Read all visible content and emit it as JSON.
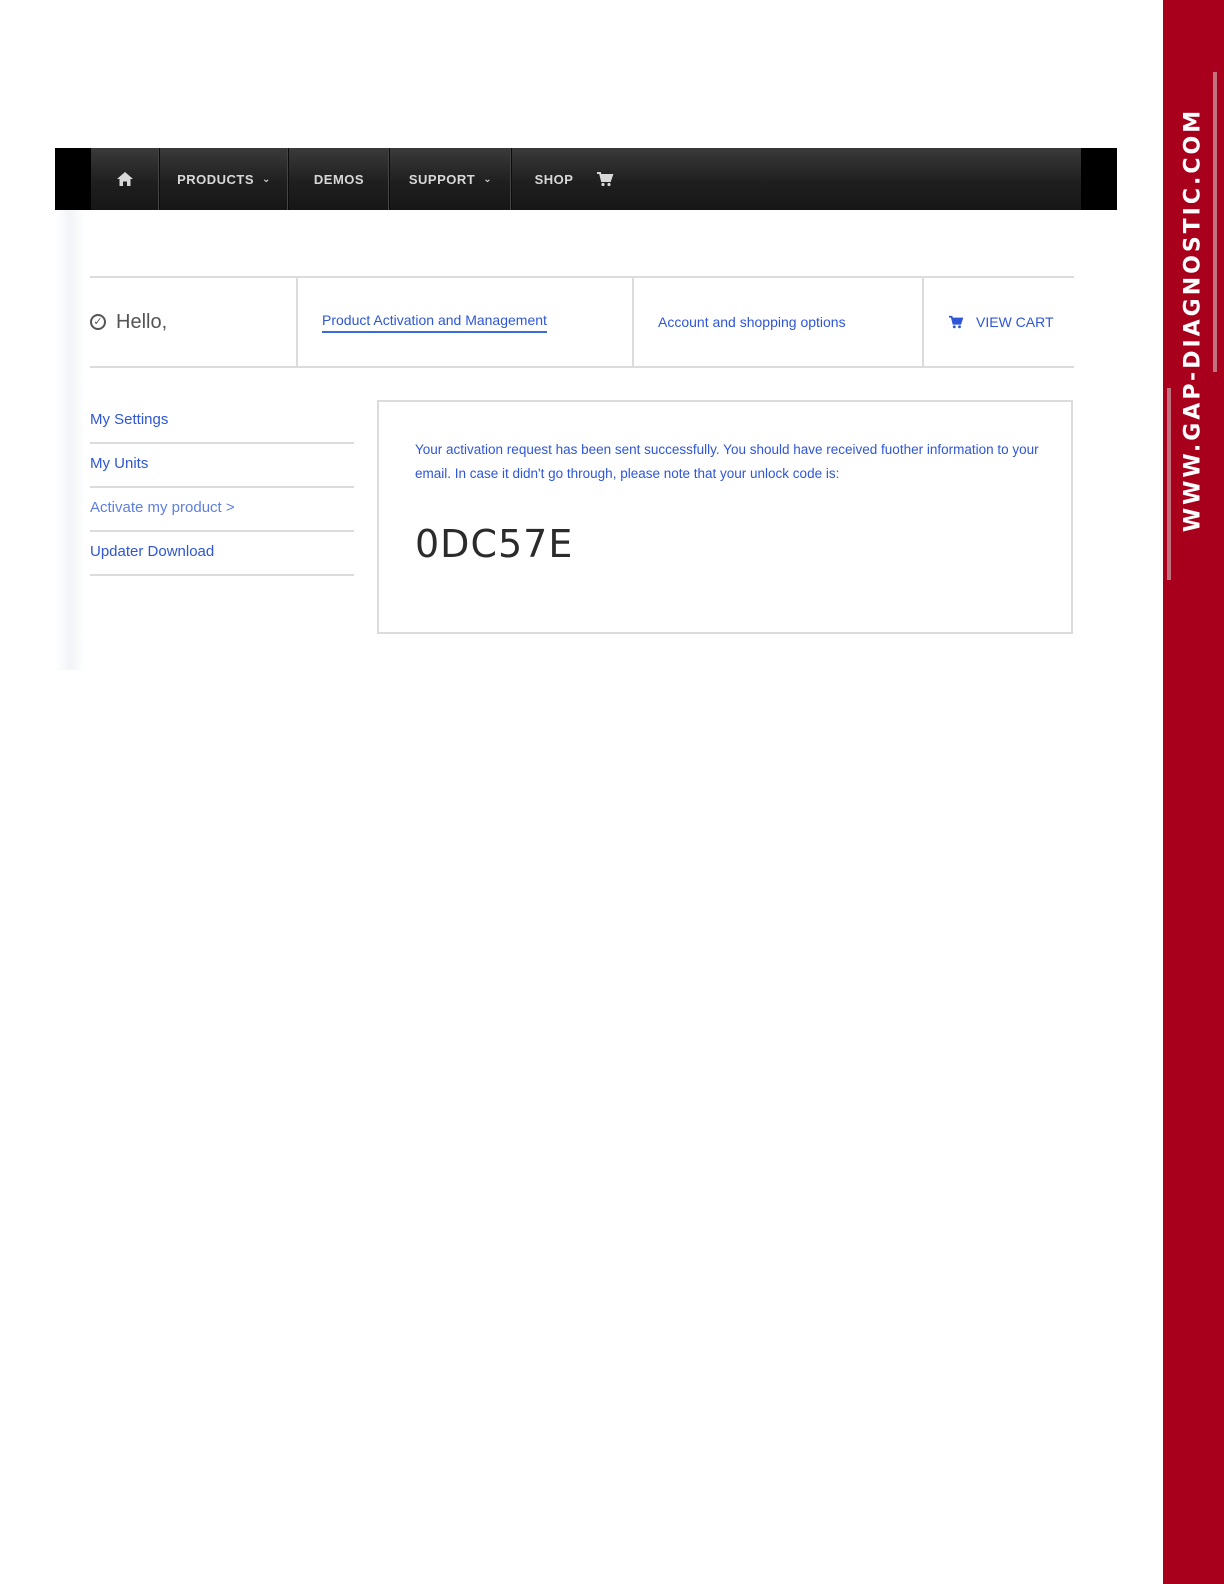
{
  "nav": {
    "items": [
      {
        "label": "",
        "icon": "home-icon"
      },
      {
        "label": "PRODUCTS",
        "dropdown": true
      },
      {
        "label": "DEMOS"
      },
      {
        "label": "SUPPORT",
        "dropdown": true
      },
      {
        "label": "SHOP"
      },
      {
        "label": "",
        "icon": "cart-icon"
      }
    ]
  },
  "header": {
    "greeting": "Hello,",
    "greeting_icon": "check-circle-icon",
    "tabs": [
      {
        "label": "Product Activation and Management",
        "active": true
      },
      {
        "label": "Account and shopping options"
      },
      {
        "label": "VIEW CART",
        "icon": "cart-icon"
      }
    ]
  },
  "sidebar": {
    "items": [
      {
        "label": "My Settings"
      },
      {
        "label": "My Units"
      },
      {
        "label": "Activate my product >"
      },
      {
        "label": "Updater Download"
      }
    ]
  },
  "message": {
    "text": "Your activation request has been sent successfully. You should have received fuother information to your email. In case it didn't go through, please note that your unlock code is:",
    "unlock_code": "0DC57E"
  },
  "brand": {
    "side_text": "WWW.GAP-DIAGNOSTIC.COM",
    "accent_color": "#a8001c",
    "link_color": "#2e56d6"
  }
}
